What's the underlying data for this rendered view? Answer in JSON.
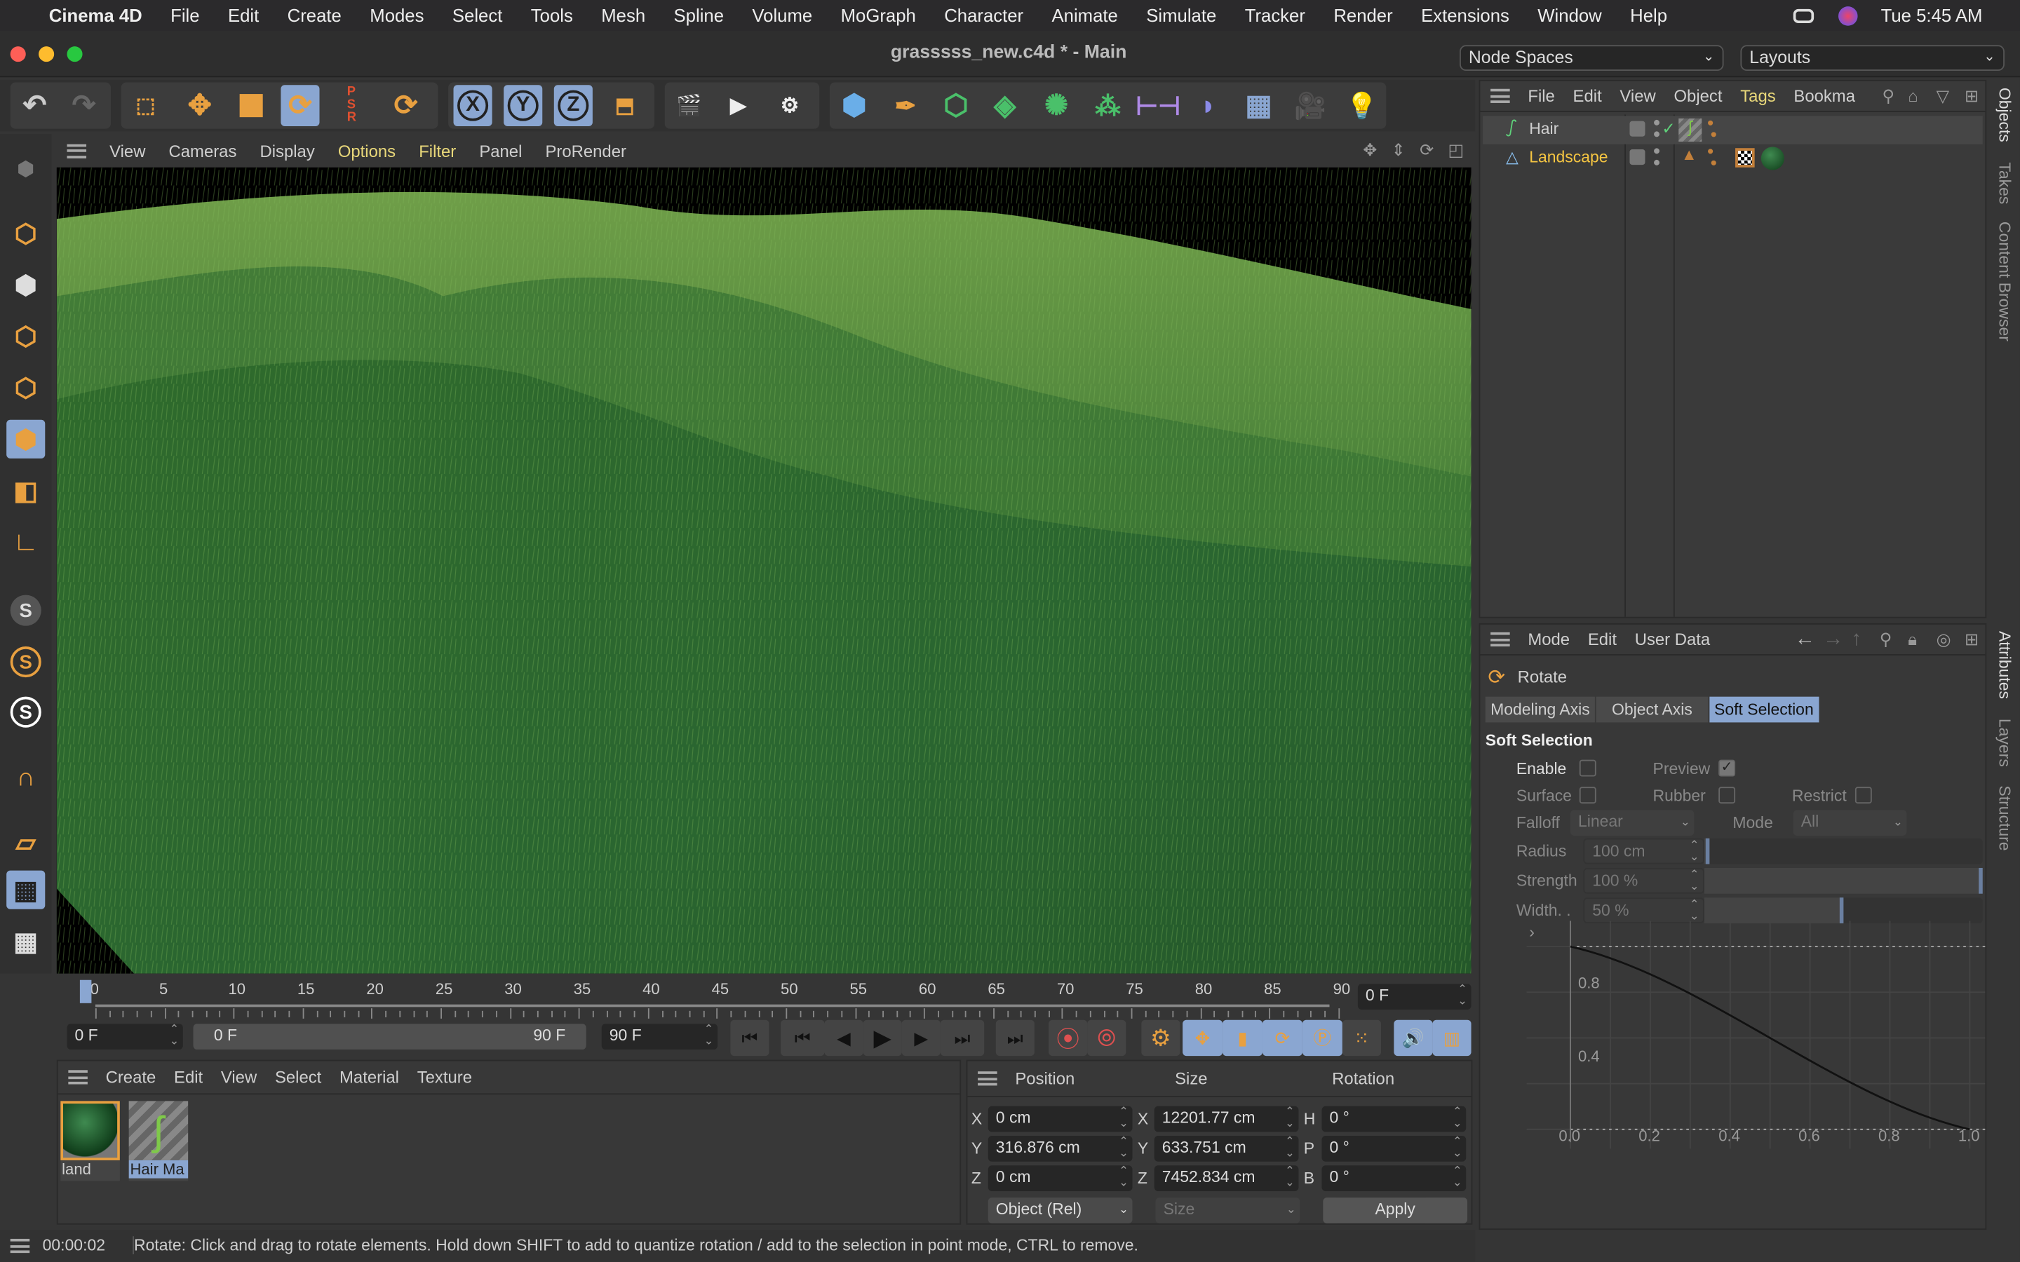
{
  "menubar": {
    "app": "Cinema 4D",
    "items": [
      "File",
      "Edit",
      "Create",
      "Modes",
      "Select",
      "Tools",
      "Mesh",
      "Spline",
      "Volume",
      "MoGraph",
      "Character",
      "Animate",
      "Simulate",
      "Tracker",
      "Render",
      "Extensions",
      "Window",
      "Help"
    ],
    "clock": "Tue  5:45 AM"
  },
  "window": {
    "title": "grasssss_new.c4d * - Main",
    "node_spaces": "Node Spaces",
    "layouts": "Layouts"
  },
  "toolbar": {
    "icons": [
      "undo-icon",
      "redo-icon",
      "live-selection-icon",
      "move-icon",
      "scale-icon",
      "rotate-icon",
      "psr-icon",
      "recent-tool-icon",
      "x-axis-icon",
      "y-axis-icon",
      "z-axis-icon",
      "coordinate-system-icon",
      "render-view-icon",
      "render-picture-viewer-icon",
      "render-settings-icon",
      "cube-icon",
      "pen-icon",
      "subdivision-icon",
      "extrude-icon",
      "cloner-icon",
      "array-icon",
      "symmetry-icon",
      "deformer-icon",
      "floor-icon",
      "camera-icon",
      "light-icon"
    ]
  },
  "viewport": {
    "menu": [
      "View",
      "Cameras",
      "Display",
      "Options",
      "Filter",
      "Panel",
      "ProRender"
    ],
    "active_menu": [
      "Options",
      "Filter"
    ]
  },
  "timeline": {
    "ticks": [
      "0",
      "5",
      "10",
      "15",
      "20",
      "25",
      "30",
      "35",
      "40",
      "45",
      "50",
      "55",
      "60",
      "65",
      "70",
      "75",
      "80",
      "85",
      "90"
    ],
    "current_frame": "0 F",
    "start": "0 F",
    "range_start": "0 F",
    "range_end": "90 F",
    "end": "90 F"
  },
  "materials": {
    "menu": [
      "Create",
      "Edit",
      "View",
      "Select",
      "Material",
      "Texture"
    ],
    "items": [
      {
        "name": "land",
        "color": "#1f5a2a"
      },
      {
        "name": "Hair Ma",
        "color": "#7fc94a"
      }
    ]
  },
  "coords": {
    "headers": [
      "Position",
      "Size",
      "Rotation"
    ],
    "rows": [
      {
        "axis": "X",
        "pos": "0 cm",
        "saxis": "X",
        "size": "12201.77 cm",
        "raxis": "H",
        "rot": "0 °"
      },
      {
        "axis": "Y",
        "pos": "316.876 cm",
        "saxis": "Y",
        "size": "633.751 cm",
        "raxis": "P",
        "rot": "0 °"
      },
      {
        "axis": "Z",
        "pos": "0 cm",
        "saxis": "Z",
        "size": "7452.834 cm",
        "raxis": "B",
        "rot": "0 °"
      }
    ],
    "mode": "Object (Rel)",
    "size_mode": "Size",
    "apply": "Apply"
  },
  "status": {
    "time": "00:00:02",
    "message": "Rotate: Click and drag to rotate elements. Hold down SHIFT to add to quantize rotation / add to the selection in point mode, CTRL to remove."
  },
  "objects": {
    "menu": [
      "File",
      "Edit",
      "View",
      "Object",
      "Tags",
      "Bookma"
    ],
    "items": [
      {
        "name": "Hair"
      },
      {
        "name": "Landscape"
      }
    ]
  },
  "side_tabs": {
    "top": [
      "Objects",
      "Takes",
      "Content Browser"
    ],
    "bottom": [
      "Attributes",
      "Layers",
      "Structure"
    ]
  },
  "attributes": {
    "menu": [
      "Mode",
      "Edit",
      "User Data"
    ],
    "tool": "Rotate",
    "tabs": [
      "Modeling Axis",
      "Object Axis",
      "Soft Selection"
    ],
    "active_tab": "Soft Selection",
    "section": "Soft Selection",
    "enable": "Enable",
    "preview": "Preview",
    "surface": "Surface",
    "rubber": "Rubber",
    "restrict": "Restrict",
    "falloff_label": "Falloff",
    "falloff": "Linear",
    "mode_label": "Mode",
    "mode": "All",
    "radius_label": "Radius",
    "radius": "100 cm",
    "strength_label": "Strength",
    "strength": "100 %",
    "width_label": "Width. .",
    "width": "50 %",
    "radius_fraction": 0.02,
    "strength_fraction": 1.0,
    "width_fraction": 0.5,
    "graph": {
      "x_ticks": [
        "0.0",
        "0.2",
        "0.4",
        "0.6",
        "0.8",
        "1.0"
      ],
      "y_ticks": [
        "0.8",
        "0.4"
      ]
    }
  },
  "colors": {
    "accent_blue": "#8aa6d1",
    "accent_orange": "#e8a040",
    "active_menu": "#e9d87a"
  }
}
